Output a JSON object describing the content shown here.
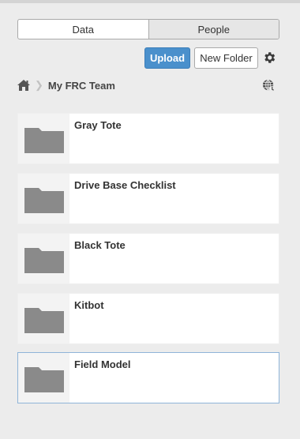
{
  "tabs": [
    {
      "label": "Data",
      "active": true
    },
    {
      "label": "People",
      "active": false
    }
  ],
  "toolbar": {
    "upload_label": "Upload",
    "new_folder_label": "New Folder",
    "settings_icon": "gear-icon"
  },
  "breadcrumb": {
    "home_icon": "home-icon",
    "current": "My FRC Team",
    "globe_icon": "globe-icon"
  },
  "folders": [
    {
      "name": "Gray Tote",
      "selected": false
    },
    {
      "name": "Drive Base Checklist",
      "selected": false
    },
    {
      "name": "Black Tote",
      "selected": false
    },
    {
      "name": "Kitbot",
      "selected": false
    },
    {
      "name": "Field Model",
      "selected": true
    }
  ],
  "colors": {
    "accent": "#4a90cc",
    "background": "#ececec",
    "selected_border": "#8fb4d8",
    "folder_gray": "#8a8a8a"
  }
}
